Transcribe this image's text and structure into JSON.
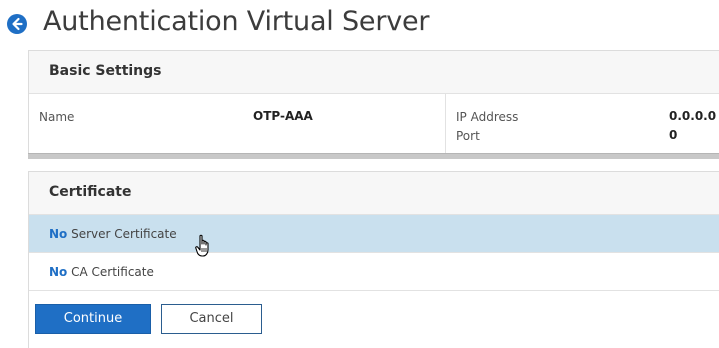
{
  "header": {
    "title": "Authentication Virtual Server",
    "back_icon": "arrow-left-circle-icon",
    "accent_color": "#1f6fc5"
  },
  "basic_settings": {
    "title": "Basic Settings",
    "name_label": "Name",
    "name_value": "OTP-AAA",
    "ip_label": "IP Address",
    "ip_value": "0.0.0.0",
    "port_label": "Port",
    "port_value": "0"
  },
  "certificate": {
    "title": "Certificate",
    "rows": [
      {
        "prefix": "No",
        "label": "Server Certificate",
        "selected": true
      },
      {
        "prefix": "No",
        "label": "CA Certificate",
        "selected": false
      }
    ]
  },
  "actions": {
    "continue_label": "Continue",
    "cancel_label": "Cancel"
  },
  "cursor": {
    "icon": "hand-pointer-icon"
  }
}
